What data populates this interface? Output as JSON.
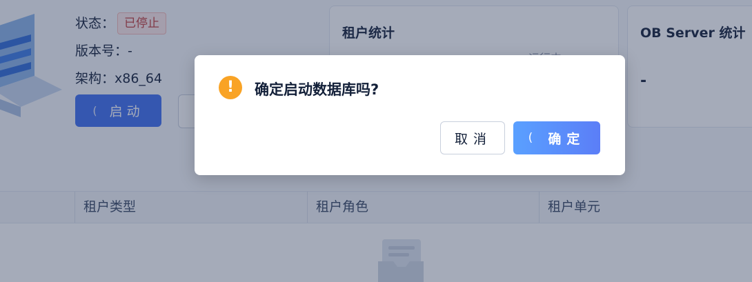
{
  "info": {
    "status_label": "状态：",
    "status_value": "已停止",
    "version_line": "版本号：-",
    "arch_line": "架构：x86_64",
    "start_button": "启动",
    "loading_glyph": "(",
    "status_color": "#c23b3b"
  },
  "cards": {
    "tenant_title": "租户统计",
    "tenant_running": "运行中",
    "server_title": "OB Server 统计",
    "server_value": "-"
  },
  "table": {
    "columns": [
      "租户类型",
      "租户角色",
      "租户单元"
    ]
  },
  "modal": {
    "icon": "warning-icon",
    "icon_glyph": "!",
    "title": "确定启动数据库吗?",
    "cancel_label": "取消",
    "ok_label": "确定",
    "ok_loading_glyph": "(",
    "accent_color": "#5b86f9",
    "warning_color": "#f9a325"
  }
}
